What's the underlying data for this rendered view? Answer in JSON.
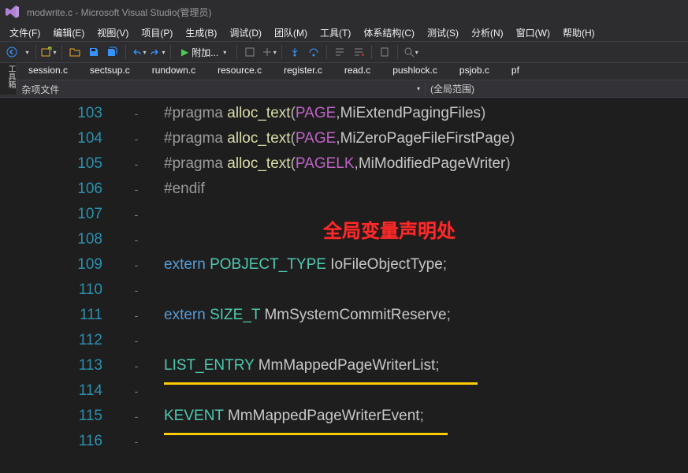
{
  "window": {
    "title": "modwrite.c - Microsoft Visual Studio(管理员)"
  },
  "menu": {
    "items": [
      "文件(F)",
      "编辑(E)",
      "视图(V)",
      "项目(P)",
      "生成(B)",
      "调试(D)",
      "团队(M)",
      "工具(T)",
      "体系结构(C)",
      "测试(S)",
      "分析(N)",
      "窗口(W)",
      "帮助(H)"
    ]
  },
  "toolbar": {
    "start_label": "附加..."
  },
  "vtool": "工具箱",
  "tabs": {
    "items": [
      "session.c",
      "sectsup.c",
      "rundown.c",
      "resource.c",
      "register.c",
      "read.c",
      "pushlock.c",
      "psjob.c",
      "pf"
    ]
  },
  "codehdr": {
    "scope1": "杂项文件",
    "scope2": "(全局范围)"
  },
  "overlay": {
    "annotation": "全局变量声明处"
  },
  "code_lines": [
    {
      "n": 103,
      "tokens": [
        [
          "pre",
          "#pragma"
        ],
        [
          "sp",
          " "
        ],
        [
          "text",
          "alloc_text"
        ],
        [
          "punc",
          "("
        ],
        [
          "page",
          "PAGE"
        ],
        [
          "punc",
          ","
        ],
        [
          "ident",
          "MiExtendPagingFiles"
        ],
        [
          "punc",
          ")"
        ]
      ]
    },
    {
      "n": 104,
      "tokens": [
        [
          "pre",
          "#pragma"
        ],
        [
          "sp",
          " "
        ],
        [
          "text",
          "alloc_text"
        ],
        [
          "punc",
          "("
        ],
        [
          "page",
          "PAGE"
        ],
        [
          "punc",
          ","
        ],
        [
          "ident",
          "MiZeroPageFileFirstPage"
        ],
        [
          "punc",
          ")"
        ]
      ]
    },
    {
      "n": 105,
      "tokens": [
        [
          "pre",
          "#pragma"
        ],
        [
          "sp",
          " "
        ],
        [
          "text",
          "alloc_text"
        ],
        [
          "punc",
          "("
        ],
        [
          "page",
          "PAGELK"
        ],
        [
          "punc",
          ","
        ],
        [
          "ident",
          "MiModifiedPageWriter"
        ],
        [
          "punc",
          ")"
        ]
      ]
    },
    {
      "n": 106,
      "tokens": [
        [
          "pre",
          "#endif"
        ]
      ]
    },
    {
      "n": 107,
      "tokens": []
    },
    {
      "n": 108,
      "tokens": []
    },
    {
      "n": 109,
      "tokens": [
        [
          "keyword",
          "extern"
        ],
        [
          "sp",
          " "
        ],
        [
          "type",
          "POBJECT_TYPE"
        ],
        [
          "sp",
          " "
        ],
        [
          "ident",
          "IoFileObjectType"
        ],
        [
          "punc",
          ";"
        ]
      ]
    },
    {
      "n": 110,
      "tokens": []
    },
    {
      "n": 111,
      "tokens": [
        [
          "keyword",
          "extern"
        ],
        [
          "sp",
          " "
        ],
        [
          "type",
          "SIZE_T"
        ],
        [
          "sp",
          " "
        ],
        [
          "ident",
          "MmSystemCommitReserve"
        ],
        [
          "punc",
          ";"
        ]
      ]
    },
    {
      "n": 112,
      "tokens": []
    },
    {
      "n": 113,
      "tokens": [
        [
          "type",
          "LIST_ENTRY"
        ],
        [
          "sp",
          " "
        ],
        [
          "ident",
          "MmMappedPageWriterList"
        ],
        [
          "punc",
          ";"
        ]
      ]
    },
    {
      "n": 114,
      "tokens": []
    },
    {
      "n": 115,
      "tokens": [
        [
          "type",
          "KEVENT"
        ],
        [
          "sp",
          " "
        ],
        [
          "ident",
          "MmMappedPageWriterEvent"
        ],
        [
          "punc",
          ";"
        ]
      ]
    },
    {
      "n": 116,
      "tokens": []
    }
  ]
}
